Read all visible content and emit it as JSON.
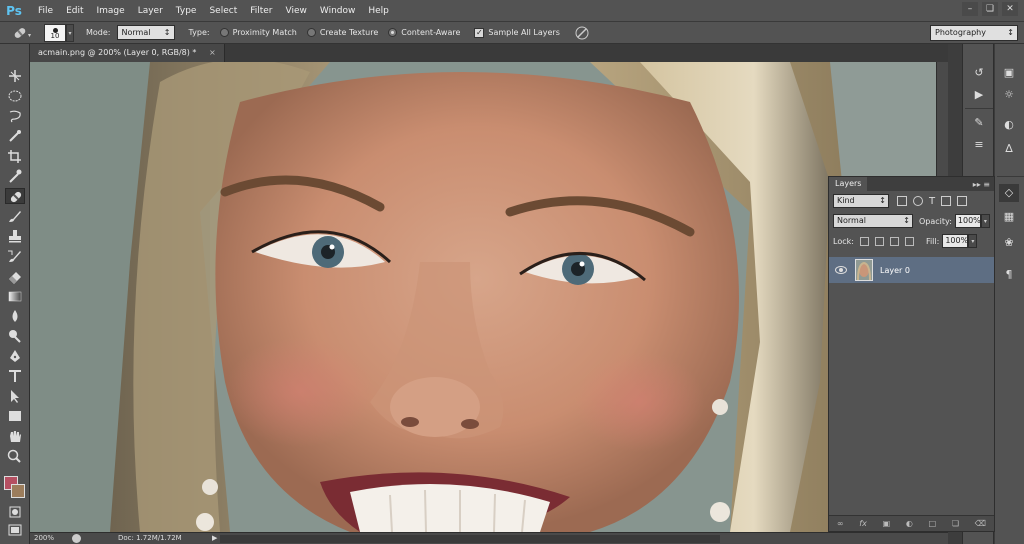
{
  "app": {
    "logo": "Ps"
  },
  "menu": [
    "File",
    "Edit",
    "Image",
    "Layer",
    "Type",
    "Select",
    "Filter",
    "View",
    "Window",
    "Help"
  ],
  "window_controls": {
    "minimize": "–",
    "restore": "❏",
    "close": "✕"
  },
  "options": {
    "brush_size": "10",
    "mode_label": "Mode:",
    "mode_value": "Normal",
    "type_label": "Type:",
    "type_options": [
      {
        "label": "Proximity Match",
        "selected": false
      },
      {
        "label": "Create Texture",
        "selected": false
      },
      {
        "label": "Content-Aware",
        "selected": true
      }
    ],
    "sample_all_layers": {
      "label": "Sample All Layers",
      "checked": true
    },
    "workspace": "Photography"
  },
  "document": {
    "tab_title": "acmain.png @ 200% (Layer 0, RGB/8) *",
    "tab_close": "×"
  },
  "status": {
    "zoom": "200%",
    "doc_size": "Doc: 1.72M/1.72M"
  },
  "colors": {
    "foreground": "#b55062",
    "background": "#9c7d5c",
    "layer_selected": "#5e6e83"
  },
  "layers_panel": {
    "tab": "Layers",
    "kind_filter": "Kind",
    "blend_mode": "Normal",
    "opacity_label": "Opacity:",
    "opacity_value": "100%",
    "lock_label": "Lock:",
    "fill_label": "Fill:",
    "fill_value": "100%",
    "layers": [
      {
        "name": "Layer 0",
        "visible": true,
        "selected": true
      }
    ],
    "footer_icons": [
      "link-icon",
      "fx-icon",
      "mask-icon",
      "adjustment-icon",
      "folder-icon",
      "new-layer-icon",
      "trash-icon"
    ]
  },
  "tools": [
    "move-tool",
    "marquee-tool",
    "lasso-tool",
    "quick-select-tool",
    "crop-tool",
    "eyedropper-tool",
    "healing-brush-tool",
    "brush-tool",
    "clone-stamp-tool",
    "history-brush-tool",
    "eraser-tool",
    "gradient-tool",
    "blur-tool",
    "dodge-tool",
    "pen-tool",
    "type-tool",
    "path-select-tool",
    "rectangle-tool",
    "hand-tool",
    "zoom-tool"
  ]
}
